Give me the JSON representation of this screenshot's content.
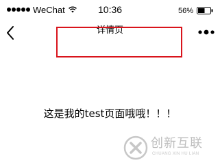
{
  "status_bar": {
    "carrier": "WeChat",
    "time": "10:36",
    "battery_percent": "56%",
    "battery_level": 0.56,
    "signal_dots": 5,
    "wifi_icon": "wifi-icon"
  },
  "nav": {
    "title": "详情页",
    "back_icon": "chevron-left-icon",
    "more_icon": "more-dots-icon"
  },
  "content": {
    "text": "这是我的test页面哦哦！！！"
  },
  "annotation": {
    "highlight_color": "#d9141c"
  },
  "watermark": {
    "name_cn": "创新互联",
    "name_en": "CHUANG XIN HU LIAN"
  }
}
